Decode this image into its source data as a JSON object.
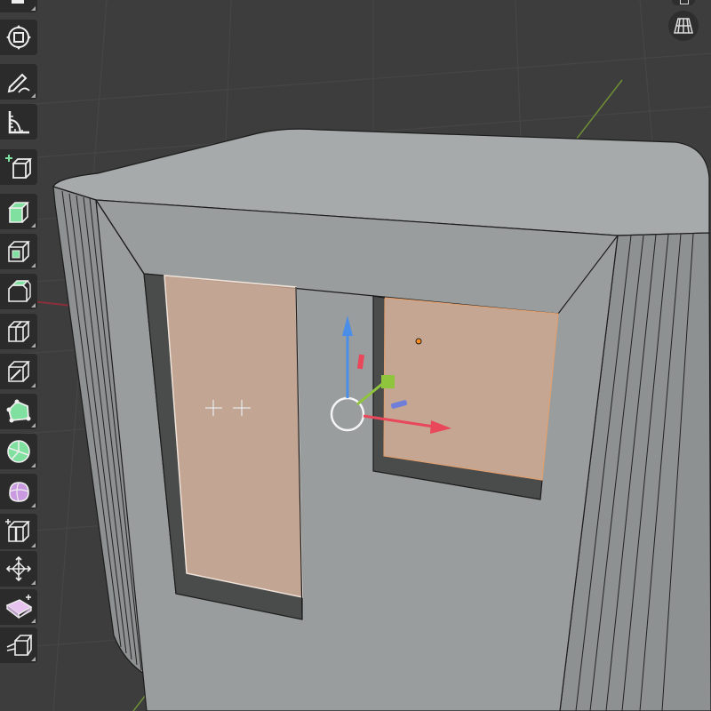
{
  "colors": {
    "viewport_bg": "#3d3d3d",
    "grid_line": "#474747",
    "mesh_face": "#9a9d9d",
    "mesh_top": "#a7aaaa",
    "mesh_edge": "#1c1c1c",
    "selected_face": "#c9a792",
    "x_axis": "#e8485a",
    "y_axis": "#8fc43d",
    "z_axis": "#4b8ee8",
    "toolbar_bg": "#2b2b2b",
    "tool_active_green": "#7fe0a0"
  },
  "toolbar": {
    "tools": [
      {
        "name": "transform-icon"
      },
      {
        "name": "annotate-icon"
      },
      {
        "name": "measure-icon"
      },
      {
        "name": "add-cube-icon"
      },
      {
        "name": "extrude-region-icon"
      },
      {
        "name": "inset-faces-icon"
      },
      {
        "name": "bevel-icon"
      },
      {
        "name": "loop-cut-icon"
      },
      {
        "name": "knife-icon"
      },
      {
        "name": "poly-build-icon"
      },
      {
        "name": "spin-icon"
      },
      {
        "name": "smooth-icon"
      },
      {
        "name": "edge-slide-icon"
      },
      {
        "name": "shrink-fatten-icon"
      },
      {
        "name": "shear-icon"
      },
      {
        "name": "rip-region-icon"
      }
    ]
  },
  "navigation": {
    "perspective_toggle": "grid-perspective-icon"
  }
}
